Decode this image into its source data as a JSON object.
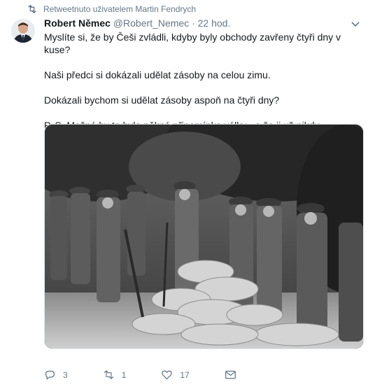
{
  "retweet": {
    "icon": "retweet-icon",
    "text": "Retweetnuto uživatelem Martin Fendrych"
  },
  "tweet": {
    "author_name": "Robert Němec",
    "handle": "@Robert_Nemec",
    "separator": "·",
    "time": "22 hod.",
    "paragraphs": [
      "Myslíte si, že by Češi zvládli, kdyby byly obchody zavřeny čtyři dny v kuse?",
      "Naši předci si dokázali udělat zásoby na celou zimu.",
      "Dokázali bychom si udělat zásoby aspoň na čtyři dny?",
      "P. S. Možná by to byla pěkná připomínka války - a že ji už nikdy nechceme."
    ]
  },
  "actions": {
    "reply_count": "3",
    "retweet_count": "1",
    "like_count": "17"
  },
  "colors": {
    "text": "#14171a",
    "secondary": "#657786",
    "border": "#e1e8ed"
  },
  "icons": [
    "retweet-icon",
    "chevron-down-icon",
    "reply-icon",
    "retweet-icon",
    "heart-icon",
    "direct-message-icon"
  ]
}
